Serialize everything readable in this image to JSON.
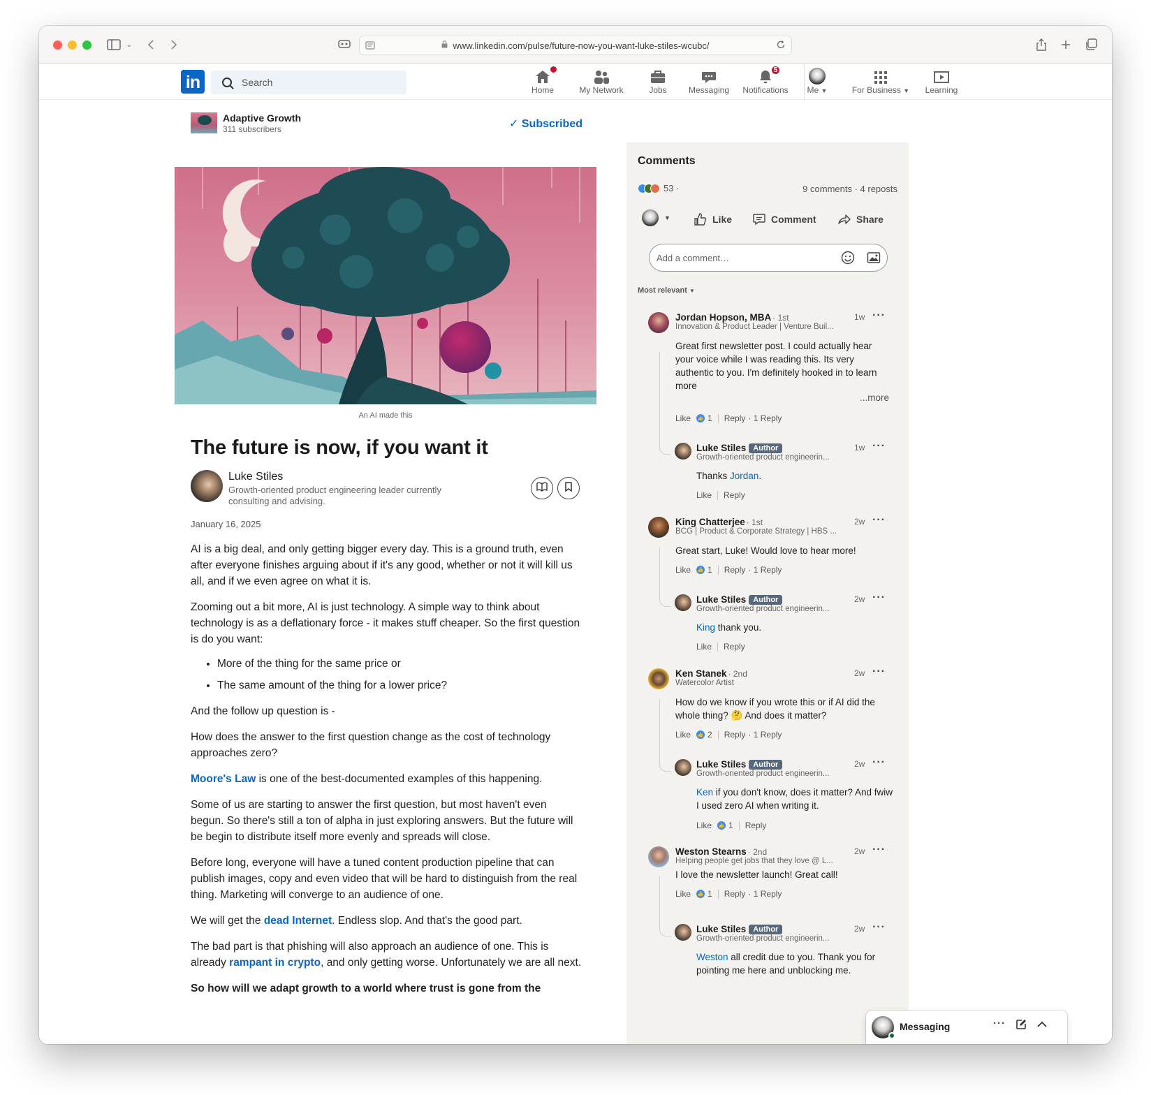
{
  "browser": {
    "url": "www.linkedin.com/pulse/future-now-you-want-luke-stiles-wcubc/"
  },
  "header": {
    "logo": "in",
    "search_placeholder": "Search",
    "nav": [
      {
        "label": "Home",
        "icon": "home-icon",
        "badge": ""
      },
      {
        "label": "My Network",
        "icon": "network-icon",
        "badge": ""
      },
      {
        "label": "Jobs",
        "icon": "briefcase-icon",
        "badge": ""
      },
      {
        "label": "Messaging",
        "icon": "messaging-icon",
        "badge": ""
      },
      {
        "label": "Notifications",
        "icon": "bell-icon",
        "badge": "5"
      },
      {
        "label": "Me",
        "icon": "avatar",
        "badge": ""
      },
      {
        "label": "For Business",
        "icon": "grid-icon",
        "badge": ""
      },
      {
        "label": "Learning",
        "icon": "learning-icon",
        "badge": ""
      }
    ]
  },
  "newsletter": {
    "name": "Adaptive Growth",
    "subscribers": "311 subscribers",
    "subscribed_label": "✓ Subscribed"
  },
  "article": {
    "caption": "An AI made this",
    "title": "The future is now, if you want it",
    "author_name": "Luke Stiles",
    "author_headline": "Growth-oriented product engineering leader currently consulting and advising.",
    "date": "January 16, 2025",
    "p1": "AI is a big deal, and only getting bigger every day. This is a ground truth, even after everyone finishes arguing about if it's any good, whether or not it will kill us all, and if we even agree on what it is.",
    "p2": "Zooming out a bit more, AI is just technology. A simple way to think about technology is as a deflationary force - it makes stuff cheaper. So the first question is do you want:",
    "bullet1": "More of the thing for the same price or",
    "bullet2": "The same amount of the thing for a lower price?",
    "p3": "And the follow up question is -",
    "p4": "How does the answer to the first question change as the cost of technology approaches zero?",
    "p5_link": "Moore's Law",
    "p5_rest": " is one of the best-documented examples of this happening.",
    "p6": "Some of us are starting to answer the first question, but most haven't even begun. So there's still a ton of alpha in just exploring answers. But the future will be begin to distribute itself more evenly and spreads will close.",
    "p7": "Before long, everyone will have a tuned content production pipeline that can publish images, copy and even video that will be hard to distinguish from the real thing. Marketing will converge to an audience of one.",
    "p8_pre": "We will get the ",
    "p8_link": "dead Internet",
    "p8_post": ". Endless slop. And that's the good part.",
    "p9_pre": "The bad part is that phishing will also approach an audience of one. This is already ",
    "p9_link": "rampant in crypto",
    "p9_post": ", and only getting worse. Unfortunately we are all next.",
    "p10": "So how will we adapt growth to a world where trust is gone from the"
  },
  "comments_panel": {
    "title": "Comments",
    "reaction_count": "53 ·",
    "counts": "9 comments · 4 reposts",
    "actions": {
      "like": "Like",
      "comment": "Comment",
      "share": "Share"
    },
    "add_placeholder": "Add a comment…",
    "sort": "Most relevant",
    "threads": [
      {
        "name": "Jordan Hopson, MBA",
        "degree": "· 1st",
        "headline": "Innovation & Product Leader | Venture Buil...",
        "time": "1w",
        "text": "Great first newsletter post. I could actually hear your voice while I was reading this. Its very authentic to you. I'm definitely hooked in to learn more",
        "more": "...more",
        "like": "Like",
        "like_count": "1",
        "reply": "Reply",
        "replies": "· 1 Reply",
        "reply_item": {
          "name": "Luke Stiles",
          "badge": "Author",
          "headline": "Growth-oriented product engineerin...",
          "time": "1w",
          "pre": "Thanks ",
          "mention": "Jordan",
          "post": ".",
          "like": "Like",
          "reply": "Reply",
          "like_count": ""
        }
      },
      {
        "name": "King Chatterjee",
        "degree": "· 1st",
        "headline": "BCG | Product & Corporate Strategy | HBS ...",
        "time": "2w",
        "text": "Great start, Luke! Would love to hear more!",
        "more": "",
        "like": "Like",
        "like_count": "1",
        "reply": "Reply",
        "replies": "· 1 Reply",
        "reply_item": {
          "name": "Luke Stiles",
          "badge": "Author",
          "headline": "Growth-oriented product engineerin...",
          "time": "2w",
          "pre": "",
          "mention": "King",
          "post": " thank you.",
          "like": "Like",
          "reply": "Reply",
          "like_count": ""
        }
      },
      {
        "name": "Ken Stanek",
        "degree": "· 2nd",
        "headline": "Watercolor Artist",
        "time": "2w",
        "text": "How do we know if you wrote this or if AI did the whole thing? 🤔 And does it matter?",
        "more": "",
        "like": "Like",
        "like_count": "2",
        "reply": "Reply",
        "replies": "· 1 Reply",
        "reply_item": {
          "name": "Luke Stiles",
          "badge": "Author",
          "headline": "Growth-oriented product engineerin...",
          "time": "2w",
          "pre": "",
          "mention": "Ken",
          "post": " if you don't know, does it matter? And fwiw I used zero AI when writing it.",
          "like": "Like",
          "reply": "Reply",
          "like_count": "1"
        }
      },
      {
        "name": "Weston Stearns",
        "degree": "· 2nd",
        "headline": "Helping people get jobs that they love @ L...",
        "time": "2w",
        "text": "I love the newsletter launch! Great call!",
        "more": "",
        "like": "Like",
        "like_count": "1",
        "reply": "Reply",
        "replies": "· 1 Reply",
        "reply_item": {
          "name": "Luke Stiles",
          "badge": "Author",
          "headline": "Growth-oriented product engineerin...",
          "time": "2w",
          "pre": "",
          "mention": "Weston",
          "post": " all credit due to you. Thank you for pointing me here and unblocking me.",
          "like": "Like",
          "reply": "Reply",
          "like_count": ""
        }
      }
    ]
  },
  "messaging": {
    "label": "Messaging"
  },
  "colors": {
    "brand": "#0a66c2",
    "badge": "#cb112d",
    "panel": "#f4f2ee"
  }
}
